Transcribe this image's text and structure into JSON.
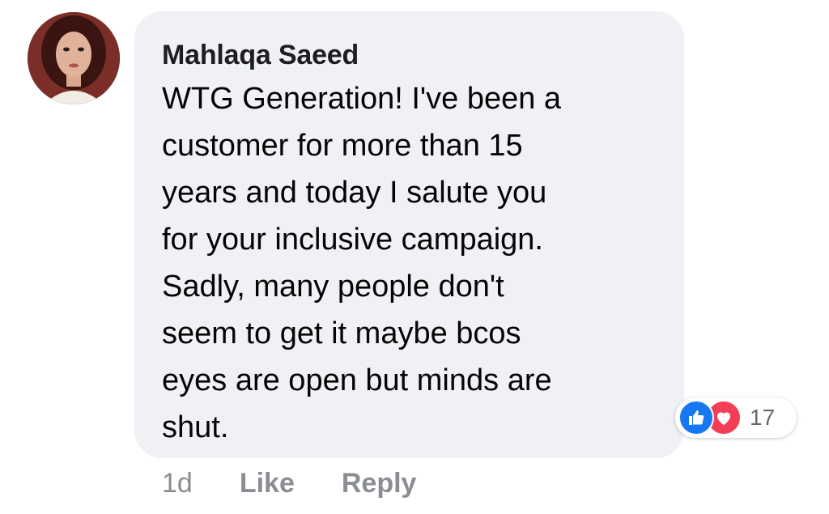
{
  "comment": {
    "author": "Mahlaqa Saeed",
    "text": "WTG Generation! I've been a\ncustomer for more than 15\nyears and today I salute you\nfor your inclusive campaign.\nSadly, many people don't\nseem to get it maybe bcos\neyes are open but minds are\nshut.",
    "avatar_icon": "profile-photo"
  },
  "reactions": {
    "icons": [
      "like-icon",
      "love-icon"
    ],
    "count": "17",
    "like_color": "#1877f2",
    "love_color": "#f33e58"
  },
  "actions": {
    "timestamp": "1d",
    "like_label": "Like",
    "reply_label": "Reply"
  }
}
